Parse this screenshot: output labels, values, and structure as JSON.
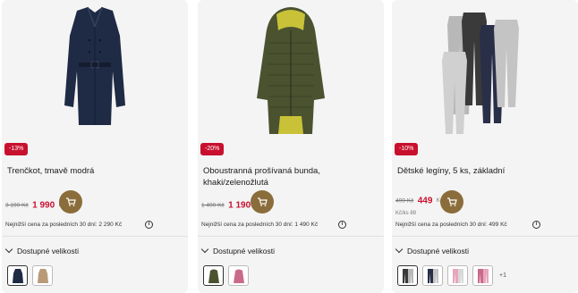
{
  "products": [
    {
      "badge": "-13%",
      "name": "Trenčkot, tmavě modrá",
      "old_price": "3 190 Kč",
      "new_price": "1 990",
      "currency": "Kč",
      "lowest_price": "Nejnižší cena za posledních 30 dní: 2 290 Kč",
      "sizes_label": "Dostupné velikosti",
      "swatch_icons": [
        "navy-coat-swatch-icon",
        "beige-coat-swatch-icon"
      ]
    },
    {
      "badge": "-20%",
      "name": "Oboustranná prošívaná bunda, khaki/zelenožlutá",
      "old_price": "1 490 Kč",
      "new_price": "1 190",
      "currency": "Kč",
      "lowest_price": "Nejnižší cena za posledních 30 dní: 1 490 Kč",
      "sizes_label": "Dostupné velikosti",
      "swatch_icons": [
        "khaki-jacket-swatch-icon",
        "pink-jacket-swatch-icon"
      ]
    },
    {
      "badge": "-10%",
      "name": "Dětské legíny, 5 ks, základní",
      "old_price": "499 Kč",
      "new_price": "449",
      "currency": "Kč",
      "unit_price": "Kč/ks 89",
      "lowest_price": "Nejnižší cena za posledních 30 dní: 499 Kč",
      "sizes_label": "Dostupné velikosti",
      "swatch_icons": [
        "grey-leggings-swatch-icon",
        "grey-leggings-swatch-icon",
        "pink-leggings-swatch-icon",
        "pink-leggings-swatch-icon"
      ],
      "more_swatches": "+1"
    }
  ],
  "info_glyph": "i",
  "colors": {
    "accent": "#c8102e",
    "cart": "#8a6d3b",
    "card_bg": "#f4f4f4"
  }
}
